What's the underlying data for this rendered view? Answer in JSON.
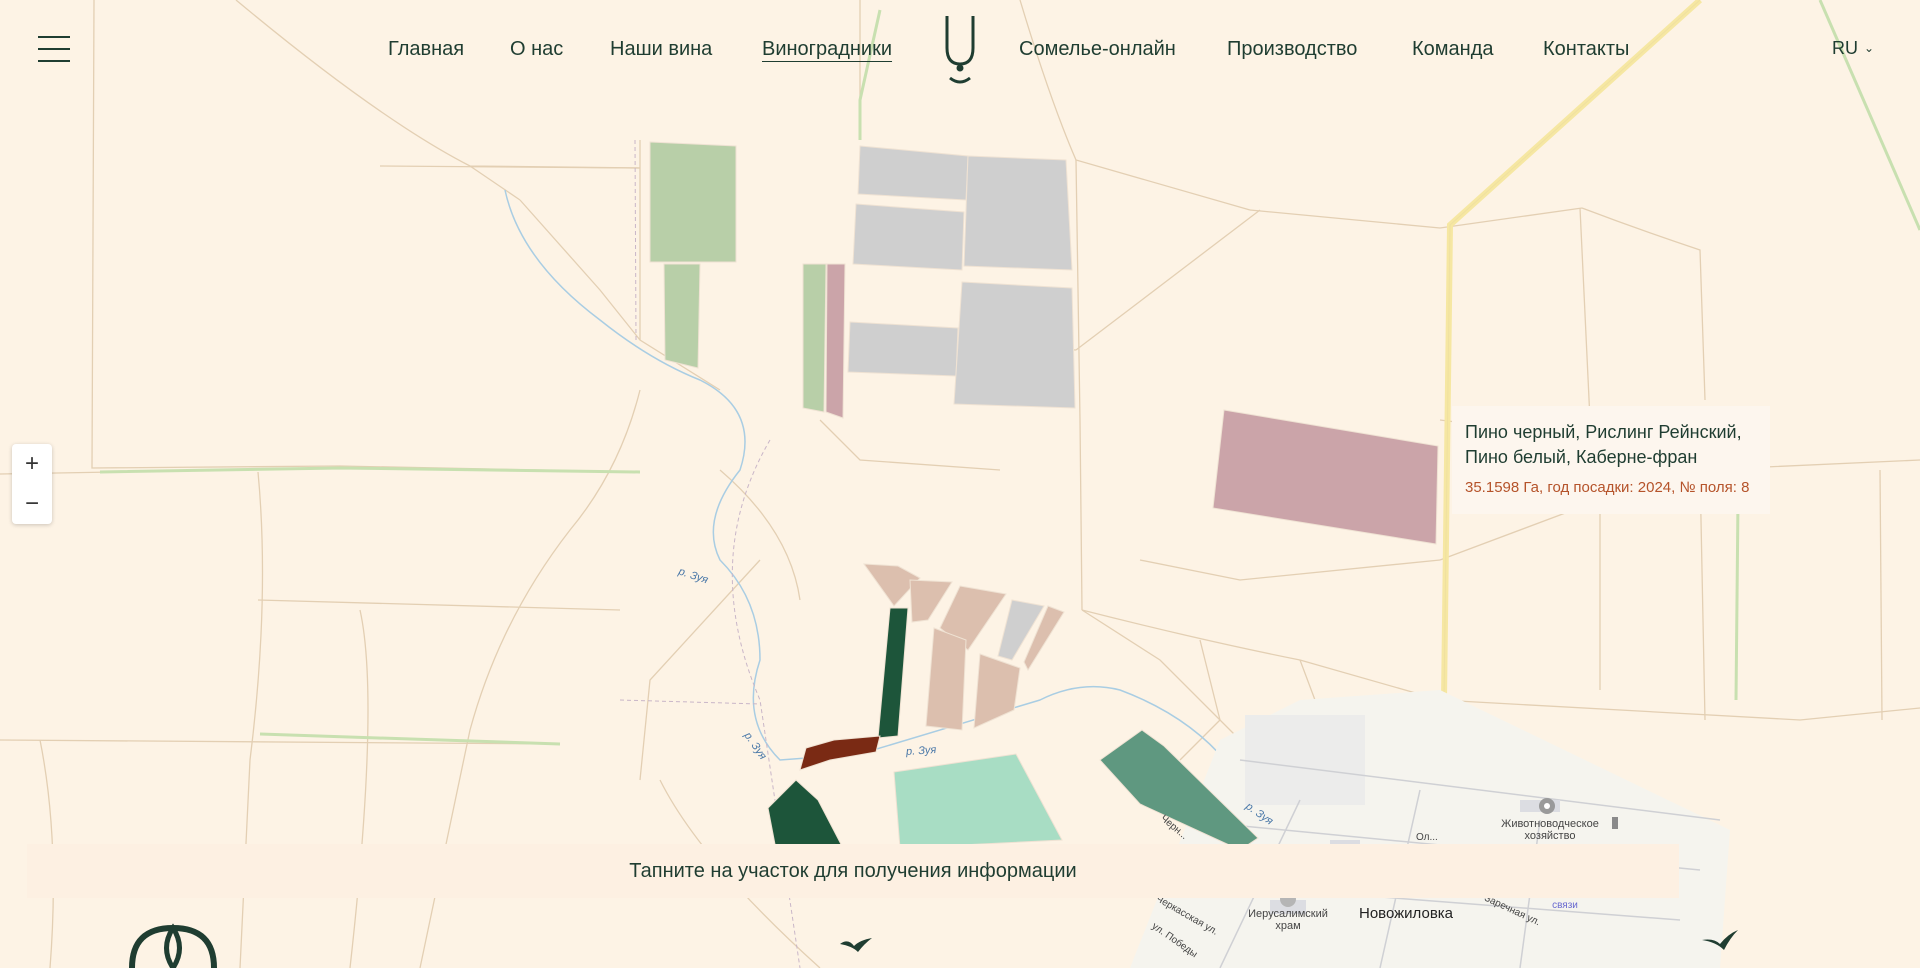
{
  "nav": {
    "items": [
      {
        "label": "Главная"
      },
      {
        "label": "О нас"
      },
      {
        "label": "Наши вина"
      },
      {
        "label": "Виноградники"
      },
      {
        "label": "Сомелье-онлайн"
      },
      {
        "label": "Производство"
      },
      {
        "label": "Команда"
      },
      {
        "label": "Контакты"
      }
    ],
    "active_label": "Виноградники",
    "lang": "RU"
  },
  "zoom": {
    "in_label": "+",
    "out_label": "−"
  },
  "tooltip": {
    "title": "Пино черный, Рислинг Рейнский, Пино белый, Каберне-фран",
    "info": "35.1598 Га, год посадки: 2024, № поля: 8"
  },
  "hint": "Тапните на участок для получения информации",
  "map_labels": {
    "river_1": "р. Зуя",
    "river_2": "р. Зуя",
    "river_3": "р. Зуя",
    "river_4": "р. Зуя",
    "livestock_farm": "Животноводческое хозяйство",
    "church": "Иерусалимский храм",
    "village": "Новожиловка",
    "street_1": "Черкасская ул.",
    "street_2": "ул. Победы",
    "street_3": "Заречная ул.",
    "street_4": "Ол...",
    "street_5": "Черн...",
    "tower": "Вышка сотовой связи"
  },
  "colors": {
    "background": "#fdf3e5",
    "text": "#1f3d31",
    "field_green_light": "#b8cfa8",
    "field_grey": "#cfcfcf",
    "field_pink": "#cba4a9",
    "field_beige": "#dcbfae",
    "field_dark_green": "#1d553a",
    "field_red_brown": "#7a2a14",
    "field_mint": "#a8ddc4",
    "field_teal": "#5f9880",
    "info_text": "#b5532a"
  },
  "icons": [
    "menu-icon",
    "chevron-down-icon",
    "logo-icon",
    "plus-icon",
    "minus-icon",
    "bird-icon"
  ]
}
